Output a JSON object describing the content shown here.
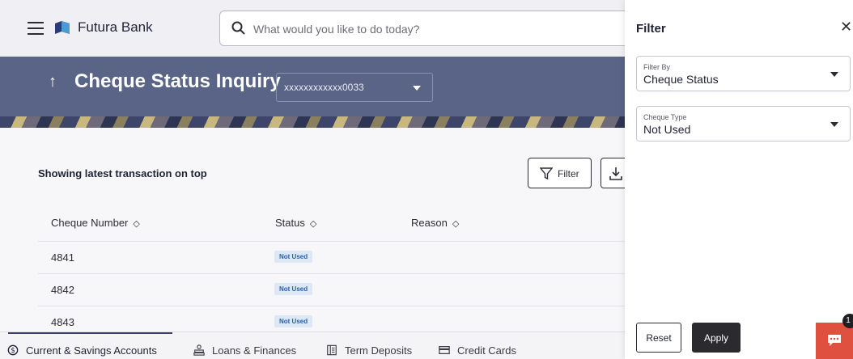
{
  "header": {
    "brand": "Futura Bank",
    "search_placeholder": "What would you like to do today?"
  },
  "page": {
    "title": "Cheque Status Inquiry",
    "account": "xxxxxxxxxxxx0033"
  },
  "list": {
    "caption": "Showing latest transaction on top",
    "filter_label": "Filter",
    "columns": [
      "Cheque Number",
      "Status",
      "Reason"
    ],
    "rows": [
      {
        "number": "4841",
        "status": "Not Used"
      },
      {
        "number": "4842",
        "status": "Not Used"
      },
      {
        "number": "4843",
        "status": "Not Used"
      }
    ]
  },
  "tabs": [
    {
      "label": "Current & Savings Accounts",
      "icon": "dollar-circle-icon"
    },
    {
      "label": "Loans & Finances",
      "icon": "loan-icon"
    },
    {
      "label": "Term Deposits",
      "icon": "deposit-icon"
    },
    {
      "label": "Credit Cards",
      "icon": "credit-card-icon"
    }
  ],
  "filter_panel": {
    "title": "Filter",
    "fields": [
      {
        "label": "Filter By",
        "value": "Cheque Status"
      },
      {
        "label": "Cheque Type",
        "value": "Not Used"
      }
    ],
    "reset_label": "Reset",
    "apply_label": "Apply"
  },
  "chat": {
    "badge": "1"
  },
  "colors": {
    "banner": "#596487",
    "apply_button": "#2b2b2f",
    "chat_widget": "#e0503e",
    "status_badge_bg": "#dde8f6",
    "status_badge_text": "#2a5ea8"
  }
}
